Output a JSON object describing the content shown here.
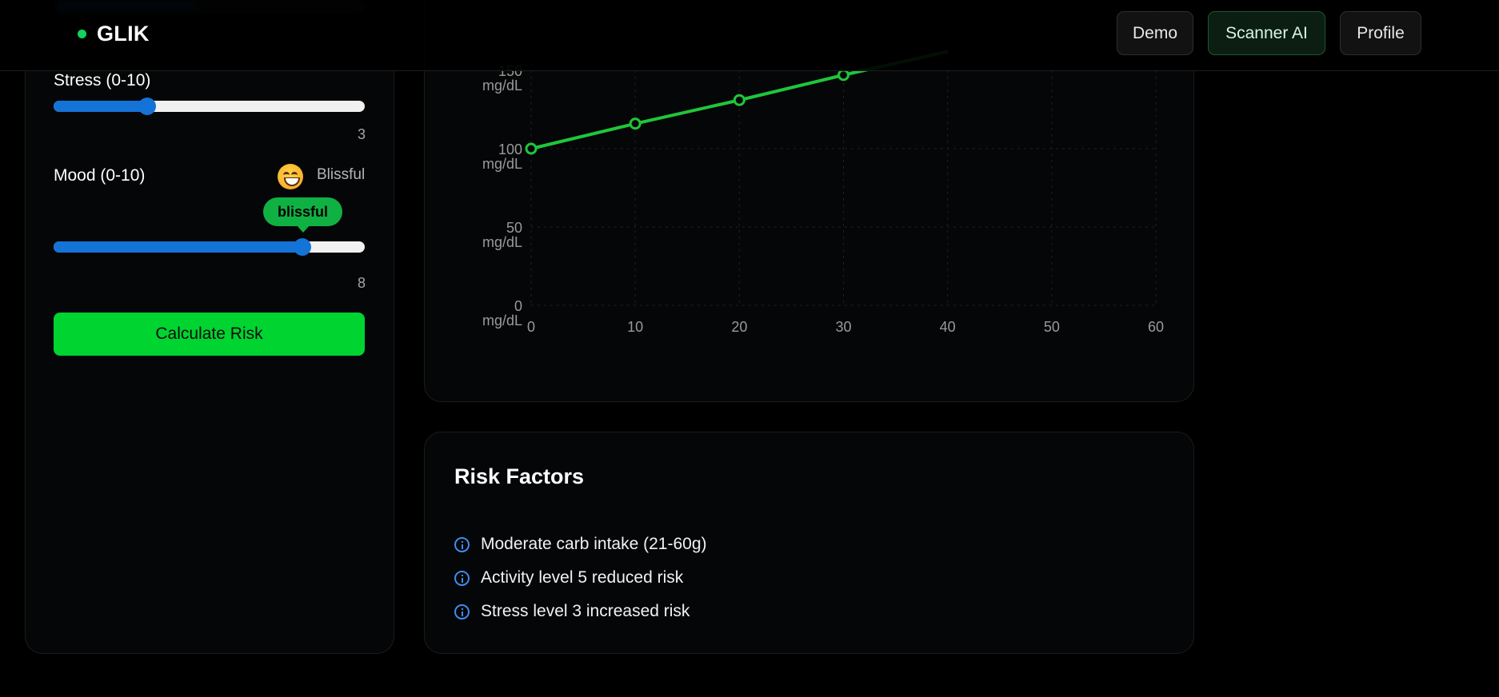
{
  "header": {
    "brand": "GLIK",
    "nav": [
      {
        "label": "Demo"
      },
      {
        "label": "Scanner AI"
      },
      {
        "label": "Profile"
      }
    ]
  },
  "inputs": {
    "stress": {
      "label": "Stress (0-10)",
      "value": "3",
      "level": 3,
      "max": 10
    },
    "mood": {
      "label": "Mood (0-10)",
      "value": "8",
      "level": 8,
      "max": 10,
      "emoji": "grinning-face",
      "word": "Blissful",
      "tooltip": "blissful"
    },
    "calculate_label": "Calculate Risk"
  },
  "chart_data": {
    "type": "line",
    "x": [
      0,
      10,
      20,
      30,
      40
    ],
    "y": [
      100,
      116,
      131,
      147,
      162
    ],
    "xticks": [
      "0",
      "10",
      "20",
      "30",
      "40",
      "50",
      "60"
    ],
    "yticks": [
      "0",
      "50",
      "100",
      "150"
    ],
    "yunit": "mg/dL",
    "xlim": [
      0,
      60
    ],
    "ylim": [
      0,
      150
    ],
    "grid": true,
    "color": "#1fc63a"
  },
  "risk_factors": {
    "title": "Risk Factors",
    "items": [
      {
        "text": "Moderate carb intake (21-60g)"
      },
      {
        "text": "Activity level 5 reduced risk"
      },
      {
        "text": "Stress level 3 increased risk"
      }
    ]
  },
  "colors": {
    "accent": "#00d431",
    "slider": "#1473d6",
    "info": "#3c8cf0"
  }
}
